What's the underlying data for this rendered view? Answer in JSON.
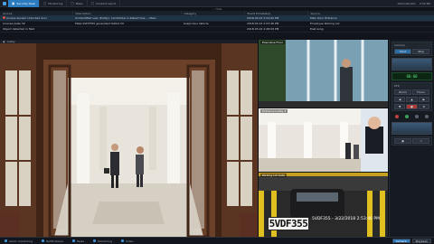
{
  "tabs": [
    {
      "label": "Security Desk",
      "active": true
    },
    {
      "label": "Monitoring",
      "active": false
    },
    {
      "label": "Maps",
      "active": false
    },
    {
      "label": "Incident report",
      "active": false
    }
  ],
  "topbar_right": {
    "user": "Administrator",
    "time": "2:54 PM"
  },
  "events": {
    "strip": "— Hide",
    "columns": [
      "Source",
      "Description",
      "Category",
      "Event timestamp",
      "Source"
    ],
    "rows": [
      {
        "source": "Access denied: Unlocked door",
        "description": "Unidentified user (Entity): Cardholder is Robert Doe — Main",
        "category": "",
        "timestamp": "2018-03-22 2:54:02 PM",
        "location": "Main Door Entrance"
      },
      {
        "source": "License plate hit",
        "description": "Plate SVDF355 generated hotlist hit",
        "category": "Suspicious Vehicle",
        "timestamp": "2018-03-22 2:53:46 PM",
        "location": "Employee Parking Lot"
      },
      {
        "source": "Object detected in field",
        "description": "",
        "category": "",
        "timestamp": "2018-03-22 2:48:09 PM",
        "location": "East wing"
      }
    ]
  },
  "main_camera": {
    "label": "Lobby"
  },
  "tiles": [
    {
      "label": "Executive Floor"
    },
    {
      "label": "Entrance Lobby 2"
    },
    {
      "label": "Parking Lot Gate"
    }
  ],
  "plate": {
    "number": "5VDF355",
    "info": "5VDF355 - 3/22/2018 2:53:46 PM"
  },
  "panel": {
    "sec1_title": "Camera",
    "btn_a": "Start",
    "btn_b": "Stop",
    "display": "00:00",
    "sec2_title": "PTZ",
    "btn_c": "Zoom",
    "btn_d": "Focus"
  },
  "taskbar": {
    "items": [
      "Alarm monitoring",
      "Notifications",
      "Tasks",
      "Monitoring",
      "Video"
    ],
    "buttons": [
      {
        "label": "Camera",
        "active": true
      },
      {
        "label": "Playback",
        "active": false
      }
    ]
  },
  "colors": {
    "accent": "#2a7bc0",
    "alert": "#d9534f",
    "display_text": "#5ee07a"
  }
}
